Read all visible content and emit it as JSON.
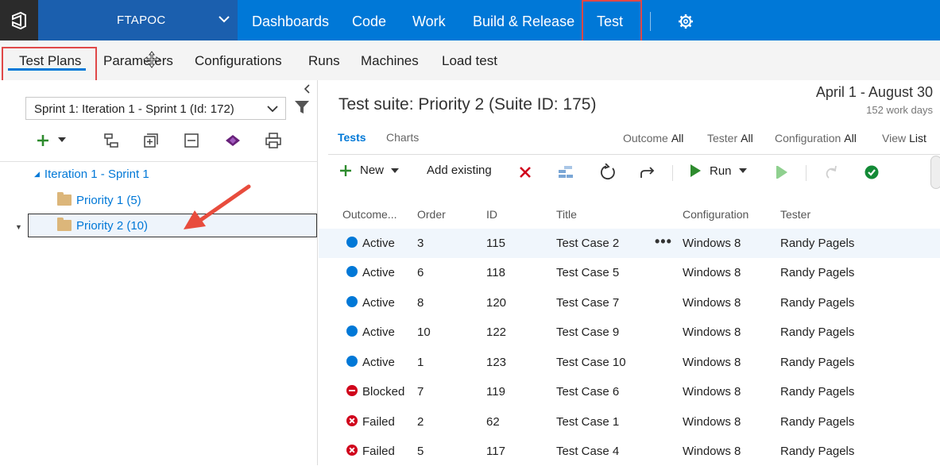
{
  "topbar": {
    "project": "FTAPOC",
    "nav": [
      "Dashboards",
      "Code",
      "Work",
      "Build & Release",
      "Test"
    ],
    "accent": "#0078d7"
  },
  "subnav": {
    "items": [
      "Test Plans",
      "Parameters",
      "Configurations",
      "Runs",
      "Machines",
      "Load test"
    ]
  },
  "left": {
    "plan_selector": "Sprint 1: Iteration 1 - Sprint 1 (Id: 172)",
    "tree": {
      "root": "Iteration 1 - Sprint 1",
      "children": [
        "Priority 1 (5)",
        "Priority 2 (10)"
      ]
    }
  },
  "right": {
    "suite_title": "Test suite: Priority 2 (Suite ID: 175)",
    "date_range": "April 1 - August 30",
    "work_days": "152 work days",
    "tabs": [
      "Tests",
      "Charts"
    ],
    "filters": [
      {
        "label": "Outcome",
        "value": "All"
      },
      {
        "label": "Tester",
        "value": "All"
      },
      {
        "label": "Configuration",
        "value": "All"
      },
      {
        "label": "View",
        "value": "List"
      }
    ],
    "toolbar": {
      "new": "New",
      "add_existing": "Add existing",
      "run": "Run"
    },
    "columns": [
      "Outcome...",
      "Order",
      "ID",
      "Title",
      "Configuration",
      "Tester"
    ],
    "rows": [
      {
        "outcome": "Active",
        "order": "3",
        "id": "115",
        "title": "Test Case 2",
        "config": "Windows 8",
        "tester": "Randy Pagels"
      },
      {
        "outcome": "Active",
        "order": "6",
        "id": "118",
        "title": "Test Case 5",
        "config": "Windows 8",
        "tester": "Randy Pagels"
      },
      {
        "outcome": "Active",
        "order": "8",
        "id": "120",
        "title": "Test Case 7",
        "config": "Windows 8",
        "tester": "Randy Pagels"
      },
      {
        "outcome": "Active",
        "order": "10",
        "id": "122",
        "title": "Test Case 9",
        "config": "Windows 8",
        "tester": "Randy Pagels"
      },
      {
        "outcome": "Active",
        "order": "1",
        "id": "123",
        "title": "Test Case 10",
        "config": "Windows 8",
        "tester": "Randy Pagels"
      },
      {
        "outcome": "Blocked",
        "order": "7",
        "id": "119",
        "title": "Test Case 6",
        "config": "Windows 8",
        "tester": "Randy Pagels"
      },
      {
        "outcome": "Failed",
        "order": "2",
        "id": "62",
        "title": "Test Case 1",
        "config": "Windows 8",
        "tester": "Randy Pagels"
      },
      {
        "outcome": "Failed",
        "order": "5",
        "id": "117",
        "title": "Test Case 4",
        "config": "Windows 8",
        "tester": "Randy Pagels"
      }
    ]
  }
}
